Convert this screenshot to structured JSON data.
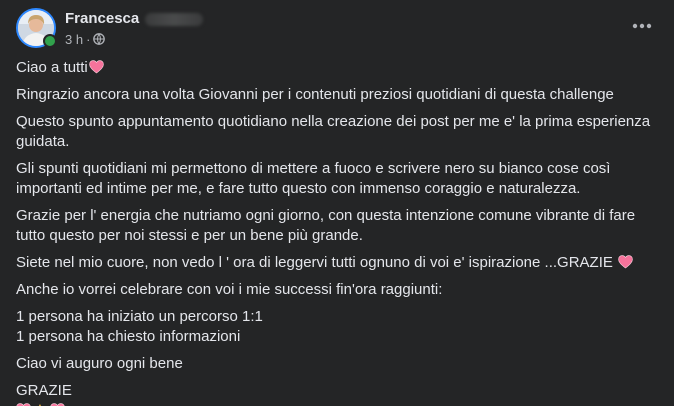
{
  "author": {
    "name": "Francesca",
    "time": "3 h",
    "separator": "·",
    "audience_icon": "globe-icon",
    "online": true
  },
  "header": {
    "more_icon": "more-horizontal-icon"
  },
  "post": {
    "greeting": "Ciao a tutti",
    "p1": "Ringrazio ancora una volta Giovanni per i contenuti preziosi quotidiani di questa challenge",
    "p2": "Questo spunto appuntamento quotidiano nella creazione dei post per me e' la prima esperienza guidata.",
    "p3_line1": "Gli spunti quotidiani mi permettono di mettere a fuoco e scrivere nero su bianco cose così",
    "p3_line2": "importanti ed intime per me, e fare tutto questo con immenso coraggio e naturalezza.",
    "p4_line1": "Grazie per l' energia che nutriamo ogni giorno, con questa intenzione comune vibrante di fare",
    "p4_line2": "tutto questo per noi stessi e per un bene più grande.",
    "p5": "Siete nel mio cuore, non vedo l ' ora di leggervi tutti ognuno di voi e' ispirazione ...GRAZIE",
    "p6": "Anche io vorrei celebrare con voi i mie successi fin'ora raggiunti:",
    "list_1": "1 persona ha iniziato un percorso 1:1",
    "list_2": "1 persona ha chiesto informazioni",
    "p8": "Ciao vi auguro ogni bene",
    "p9": "GRAZIE",
    "final_emojis": [
      "heart-icon",
      "folded-hands-icon",
      "heart-icon"
    ]
  },
  "colors": {
    "background": "#242526",
    "text_primary": "#e4e6eb",
    "text_secondary": "#b0b3b8",
    "heart_pink": "#f5739b",
    "online_green": "#31a24c"
  }
}
